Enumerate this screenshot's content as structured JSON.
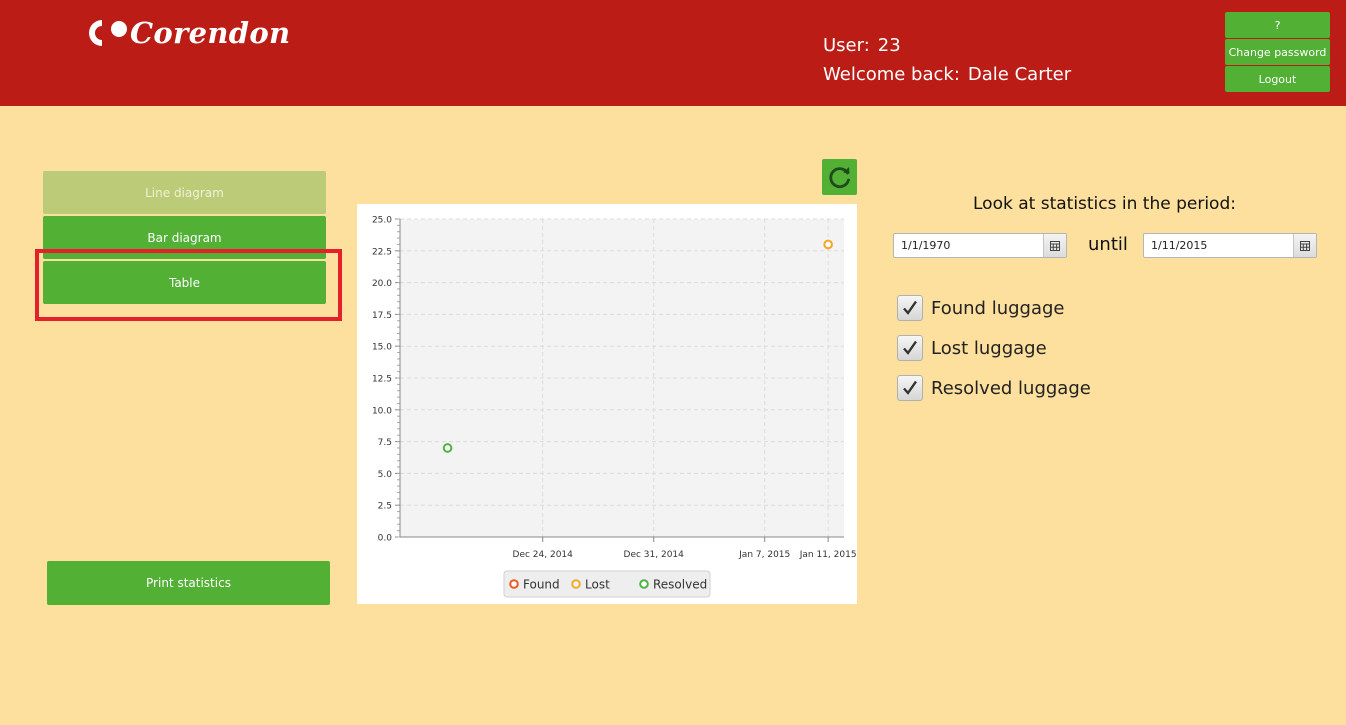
{
  "app": {
    "logo_text": "Corendon"
  },
  "header": {
    "user_label": "User:",
    "user_value": "23",
    "welcome_label": "Welcome back:",
    "welcome_value": "Dale Carter",
    "help_label": "?",
    "change_password_label": "Change password",
    "logout_label": "Logout"
  },
  "sidebar": {
    "line_diagram_label": "Line diagram",
    "bar_diagram_label": "Bar diagram",
    "table_label": "Table",
    "print_label": "Print statistics"
  },
  "filters": {
    "period_label": "Look at statistics in the period:",
    "from_date": "1/1/1970",
    "until_label": "until",
    "to_date": "1/11/2015",
    "checkboxes": [
      {
        "label": "Found luggage",
        "checked": true
      },
      {
        "label": "Lost luggage",
        "checked": true
      },
      {
        "label": "Resolved luggage",
        "checked": true
      }
    ]
  },
  "colors": {
    "header_red": "#bb1c16",
    "accent_green": "#52b035",
    "background": "#fde09e",
    "found": "#ef5a22",
    "lost": "#f5a623",
    "resolved": "#4fb043"
  },
  "chart_data": {
    "type": "scatter",
    "y_ticks": [
      "0.0",
      "2.5",
      "5.0",
      "7.5",
      "10.0",
      "12.5",
      "15.0",
      "17.5",
      "20.0",
      "22.5",
      "25.0"
    ],
    "ylim": [
      0,
      25
    ],
    "x_ticks": [
      "Dec 24, 2014",
      "Dec 31, 2014",
      "Jan 7, 2015",
      "Jan 11, 2015"
    ],
    "grid": true,
    "legend_position": "bottom",
    "series": [
      {
        "name": "Found",
        "color": "#ef5a22",
        "points": []
      },
      {
        "name": "Lost",
        "color": "#f5a623",
        "points": [
          {
            "x": "Jan 11, 2015",
            "y": 23
          }
        ]
      },
      {
        "name": "Resolved",
        "color": "#4fb043",
        "points": [
          {
            "x": "Dec 18, 2014",
            "y": 7
          }
        ]
      }
    ]
  }
}
